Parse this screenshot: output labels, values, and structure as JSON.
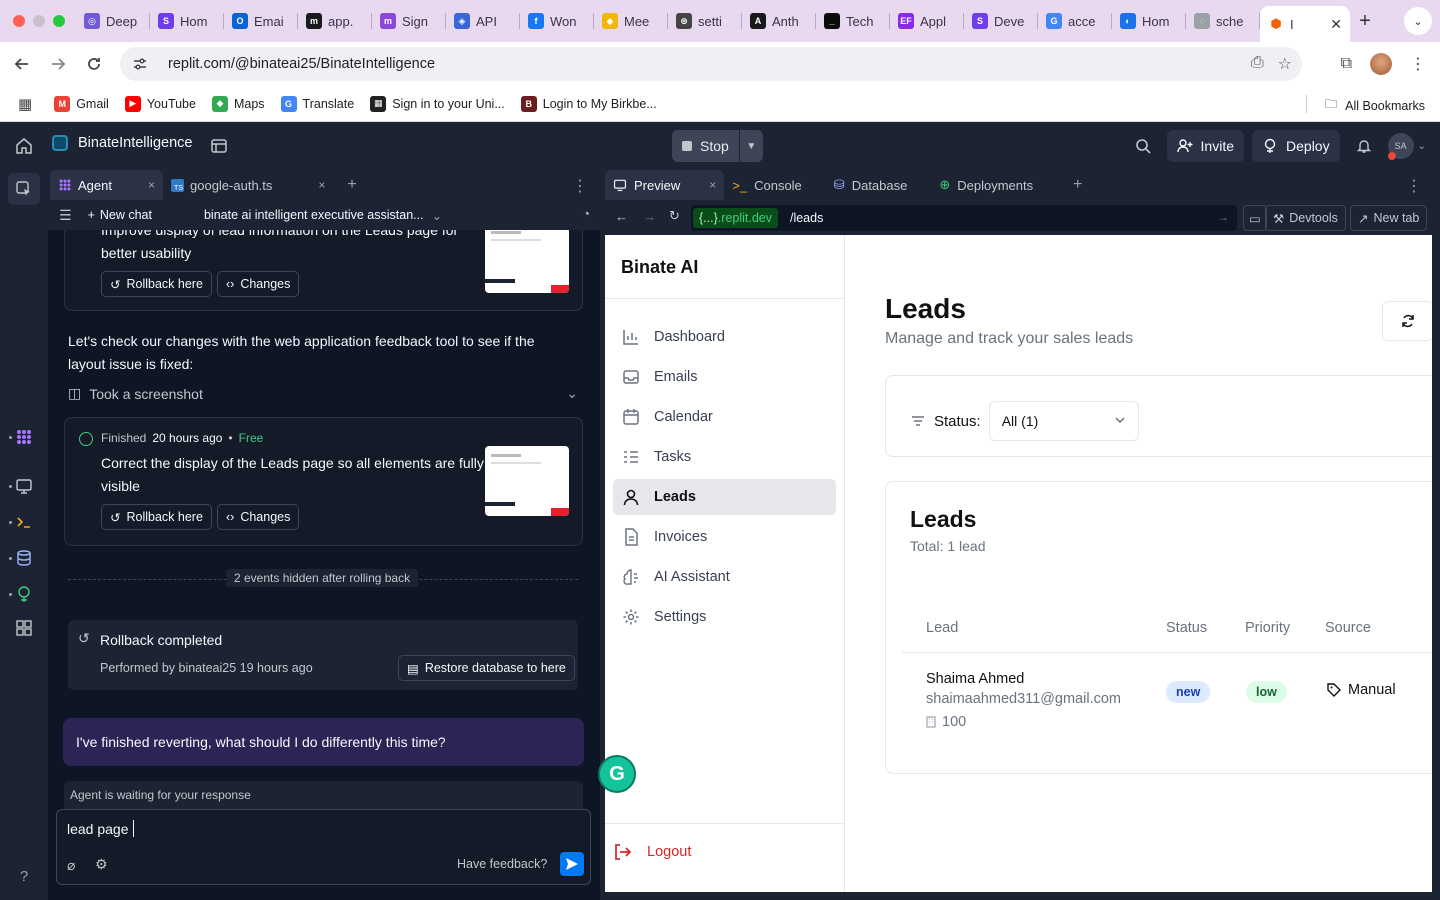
{
  "browser": {
    "tabs": [
      {
        "label": "Deep",
        "icon": "#6f5bd8",
        "glyph": "◎"
      },
      {
        "label": "Hom",
        "icon": "#6f3ee8",
        "glyph": "S"
      },
      {
        "label": "Emai",
        "icon": "#0a64d6",
        "glyph": "O"
      },
      {
        "label": "app.",
        "icon": "#1a1a1a",
        "glyph": "m"
      },
      {
        "label": "Sign",
        "icon": "#8a48d8",
        "glyph": "m"
      },
      {
        "label": "API",
        "icon": "#3867d6",
        "glyph": "◈"
      },
      {
        "label": "Won",
        "icon": "#1877f2",
        "glyph": "f"
      },
      {
        "label": "Mee",
        "icon": "#f2b705",
        "glyph": "◆"
      },
      {
        "label": "setti",
        "icon": "#444",
        "glyph": "⊛"
      },
      {
        "label": "Anth",
        "icon": "#191919",
        "glyph": "A"
      },
      {
        "label": "Tech",
        "icon": "#0b0b0b",
        "glyph": "_"
      },
      {
        "label": "Appl",
        "icon": "#8a2be2",
        "glyph": "EF"
      },
      {
        "label": "Deve",
        "icon": "#6f3ee8",
        "glyph": "S"
      },
      {
        "label": "acce",
        "icon": "#4285f4",
        "glyph": "G"
      },
      {
        "label": "Hom",
        "icon": "#1a73e8",
        "glyph": "◐"
      },
      {
        "label": "sche",
        "icon": "#9aa0a6",
        "glyph": "◌"
      }
    ],
    "active_tab": {
      "label": "I",
      "icon": "#f26207",
      "glyph": "⬢"
    },
    "url": "replit.com/@binateai25/BinateIntelligence",
    "bookmarks": [
      {
        "label": "Gmail",
        "icon": "#ea4335",
        "glyph": "M"
      },
      {
        "label": "YouTube",
        "icon": "#ff0000",
        "glyph": "▶"
      },
      {
        "label": "Maps",
        "icon": "#34a853",
        "glyph": "◆"
      },
      {
        "label": "Translate",
        "icon": "#4285f4",
        "glyph": "G"
      },
      {
        "label": "Sign in to your Uni...",
        "icon": "#222",
        "glyph": "▦"
      },
      {
        "label": "Login to My Birkbe...",
        "icon": "#6b1e1e",
        "glyph": "B"
      }
    ],
    "all_bookmarks": "All Bookmarks"
  },
  "workspace": {
    "repl_name": "BinateIntelligence",
    "stop_label": "Stop",
    "invite_label": "Invite",
    "deploy_label": "Deploy",
    "user_initials": "SA"
  },
  "agent": {
    "tabs": [
      {
        "label": "Agent",
        "close": "×"
      },
      {
        "label": "google-auth.ts",
        "close": "×"
      }
    ],
    "new_chat": "New chat",
    "chat_title": "binate ai intelligent executive assistan...",
    "checkpoint1_text_top": "Improve display of lead information on the Leads page for",
    "checkpoint1_text_bottom": "better usability",
    "rollback_label": "Rollback here",
    "changes_label": "Changes",
    "message": "Let's check our changes with the web application feedback tool to see if the layout issue is fixed:",
    "tool_label": "Took a screenshot",
    "finished_label": "Finished",
    "finished_time": "20 hours ago",
    "free_label": "Free",
    "checkpoint2_text": "Correct the display of the Leads page so all elements are fully visible",
    "hidden_events": "2 events hidden after rolling back",
    "rollback_completed": "Rollback completed",
    "performed_by": "Performed by binateai25 19 hours ago",
    "restore_db": "Restore database to here",
    "user_message": "I've finished reverting, what should I do differently this time?",
    "waiting": "Agent is waiting for your response",
    "input_value": "lead page",
    "feedback": "Have feedback?"
  },
  "preview": {
    "tabs": [
      "Preview",
      "Console",
      "Database",
      "Deployments"
    ],
    "dev_domain": ".replit.dev",
    "dev_brace": "{...}",
    "path": "/leads",
    "devtools": "Devtools",
    "new_tab": "New tab"
  },
  "app": {
    "brand": "Binate AI",
    "nav": [
      "Dashboard",
      "Emails",
      "Calendar",
      "Tasks",
      "Leads",
      "Invoices",
      "AI Assistant",
      "Settings"
    ],
    "active_nav": "Leads",
    "logout": "Logout",
    "page_title": "Leads",
    "page_subtitle": "Manage and track your sales leads",
    "status_label": "Status:",
    "status_value": "All (1)",
    "card_title": "Leads",
    "card_subtitle": "Total: 1 lead",
    "columns": [
      "Lead",
      "Status",
      "Priority",
      "Source"
    ],
    "rows": [
      {
        "name": "Shaima Ahmed",
        "email": "shaimaahmed311@gmail.com",
        "value": "100",
        "status": "new",
        "priority": "low",
        "source": "Manual"
      }
    ]
  },
  "colors": {
    "replit_bg": "#1c2333",
    "agent_bg": "#0e1525",
    "accent_green": "#3fcd7f",
    "logout_red": "#dc2626"
  }
}
